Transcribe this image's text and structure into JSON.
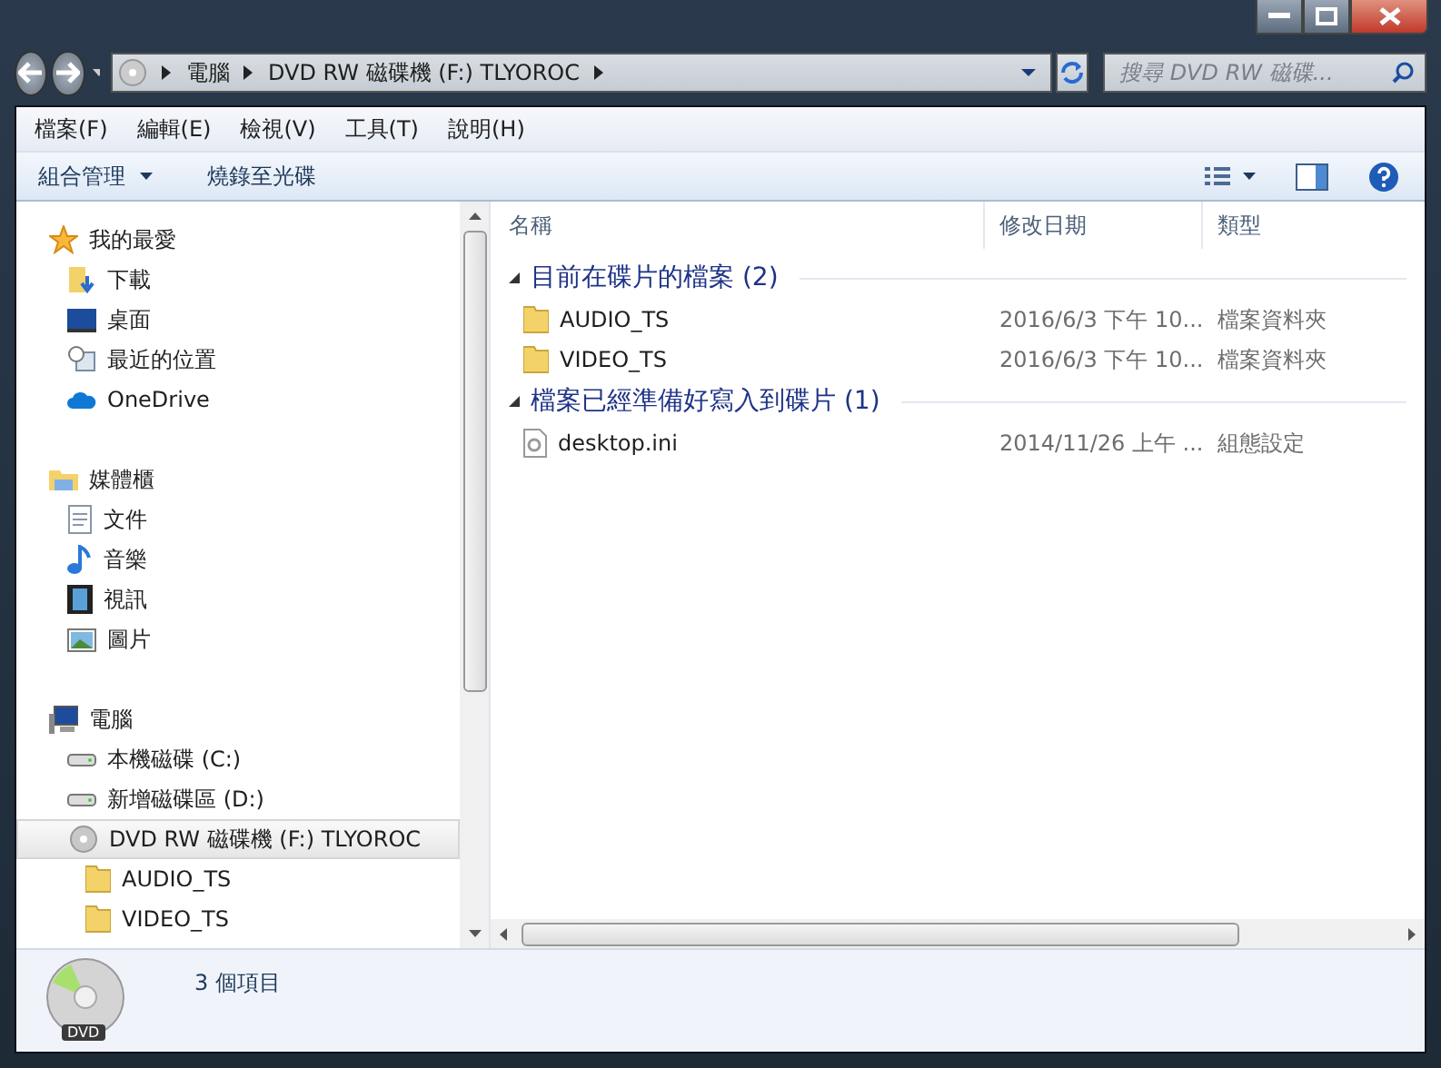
{
  "address": {
    "crumbs": [
      "電腦",
      "DVD RW 磁碟機 (F:) TLYOROC"
    ]
  },
  "search": {
    "placeholder": "搜尋 DVD RW 磁碟..."
  },
  "menu": [
    "檔案(F)",
    "編輯(E)",
    "檢視(V)",
    "工具(T)",
    "說明(H)"
  ],
  "toolbar": [
    {
      "label": "組合管理",
      "dropdown": true
    },
    {
      "label": "燒錄至光碟",
      "dropdown": false
    }
  ],
  "nav": [
    {
      "label": "我的最愛",
      "kind": "star",
      "children": [
        {
          "label": "下載",
          "kind": "download"
        },
        {
          "label": "桌面",
          "kind": "desktop"
        },
        {
          "label": "最近的位置",
          "kind": "recent"
        },
        {
          "label": "OneDrive",
          "kind": "cloud"
        }
      ]
    },
    {
      "label": "媒體櫃",
      "kind": "library",
      "children": [
        {
          "label": "文件",
          "kind": "document"
        },
        {
          "label": "音樂",
          "kind": "music"
        },
        {
          "label": "視訊",
          "kind": "video"
        },
        {
          "label": "圖片",
          "kind": "picture"
        }
      ]
    },
    {
      "label": "電腦",
      "kind": "computer",
      "children": [
        {
          "label": "本機磁碟 (C:)",
          "kind": "drive",
          "selected": false
        },
        {
          "label": "新增磁碟區 (D:)",
          "kind": "drive",
          "selected": false
        },
        {
          "label": "DVD RW 磁碟機 (F:) TLYOROC",
          "kind": "disc",
          "selected": true,
          "children": [
            {
              "label": "AUDIO_TS",
              "kind": "folder"
            },
            {
              "label": "VIDEO_TS",
              "kind": "folder"
            }
          ]
        }
      ]
    }
  ],
  "columns": [
    "名稱",
    "修改日期",
    "類型"
  ],
  "groups": [
    {
      "title": "目前在碟片的檔案 (2)",
      "expanded": true,
      "rows": [
        {
          "name": "AUDIO_TS",
          "kind": "folder",
          "date": "2016/6/3 下午 10...",
          "type": "檔案資料夾"
        },
        {
          "name": "VIDEO_TS",
          "kind": "folder",
          "date": "2016/6/3 下午 10...",
          "type": "檔案資料夾"
        }
      ]
    },
    {
      "title": "檔案已經準備好寫入到碟片 (1)",
      "expanded": true,
      "rows": [
        {
          "name": "desktop.ini",
          "kind": "settings-file",
          "date": "2014/11/26 上午 ...",
          "type": "組態設定"
        }
      ]
    }
  ],
  "status_bar": {
    "icon_label": "DVD",
    "text": "3 個項目"
  }
}
